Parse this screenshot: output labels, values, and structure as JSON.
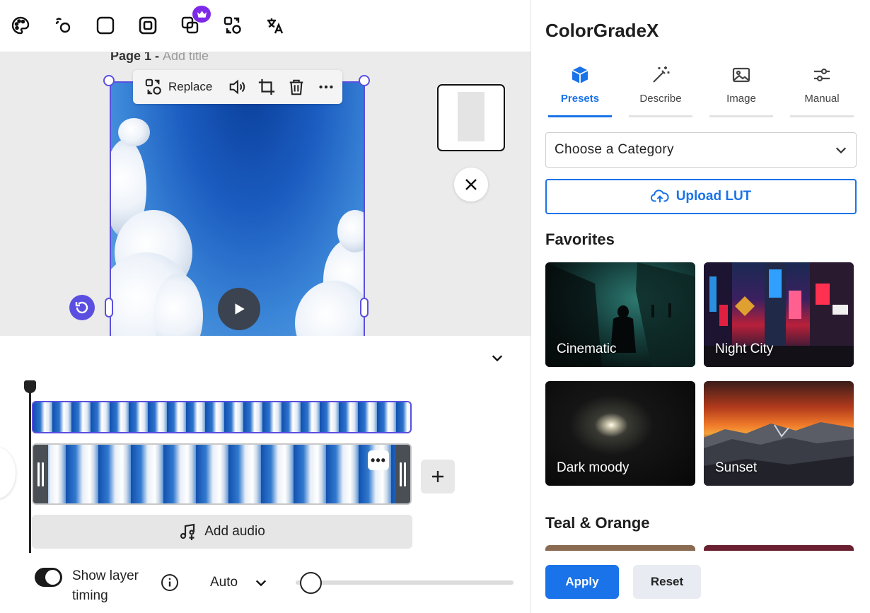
{
  "editor": {
    "toolbar": {
      "icons": [
        "palette-icon",
        "shapes-link-icon",
        "square-icon",
        "frame-icon",
        "layers-icon",
        "swap-icon",
        "translate-icon"
      ],
      "premium_badge": "crown-icon"
    },
    "canvas": {
      "page_label": "Page 1 - ",
      "page_placeholder": "Add title",
      "float_toolbar": {
        "replace_label": "Replace"
      }
    },
    "timeline": {
      "add_audio_label": "Add audio",
      "show_layer_timing_label": "Show layer timing",
      "show_layer_timing_on": true,
      "speed_value": "Auto",
      "clip_menu_label": "•••"
    }
  },
  "panel": {
    "app_title": "ColorGradeX",
    "tabs": [
      {
        "label": "Presets",
        "icon": "cube-icon",
        "active": true
      },
      {
        "label": "Describe",
        "icon": "magic-wand-icon",
        "active": false
      },
      {
        "label": "Image",
        "icon": "image-icon",
        "active": false
      },
      {
        "label": "Manual",
        "icon": "sliders-icon",
        "active": false
      }
    ],
    "category_placeholder": "Choose a Category",
    "upload_lut_label": "Upload LUT",
    "sections": [
      {
        "title": "Favorites",
        "presets": [
          "Cinematic",
          "Night City",
          "Dark moody",
          "Sunset"
        ]
      },
      {
        "title": "Teal & Orange"
      }
    ],
    "apply_label": "Apply",
    "reset_label": "Reset"
  },
  "colors": {
    "accent": "#1a73e8",
    "selection": "#5a4fe0",
    "premium": "#7d2ae8"
  }
}
